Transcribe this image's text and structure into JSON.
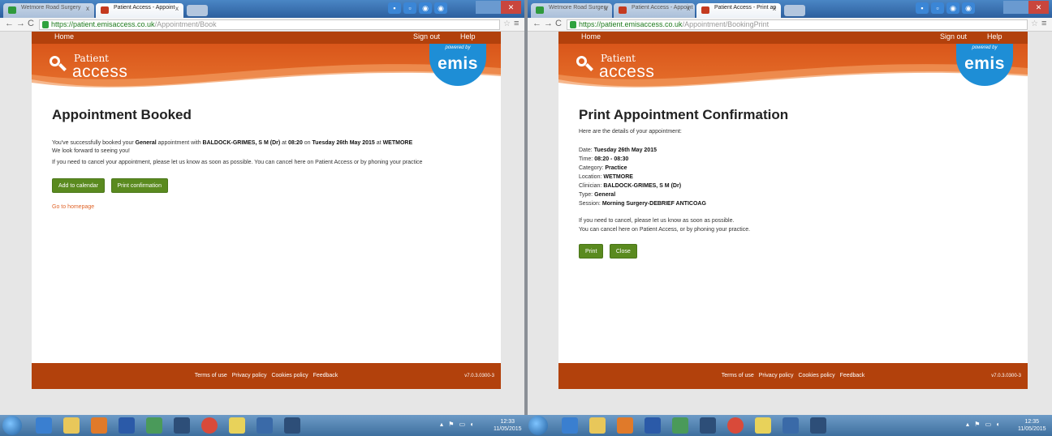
{
  "left_window": {
    "tabs": [
      {
        "label": "Wetmore Road Surgery"
      },
      {
        "label": "Patient Access - Appoint"
      }
    ],
    "url": {
      "host": "https://patient.emisaccess.co.uk",
      "path": "/Appointment/Book"
    },
    "site": {
      "nav": {
        "home": "Home",
        "sign_out": "Sign out",
        "help": "Help"
      },
      "logo": {
        "line1": "Patient",
        "line2": "access"
      },
      "emis": {
        "powered_by": "powered by",
        "name": "emis"
      },
      "title": "Appointment Booked",
      "message": {
        "p1_a": "You've successfully booked your ",
        "type": "General",
        "p1_b": " appointment with ",
        "clinician": "BALDOCK-GRIMES, S M (Dr)",
        "p1_c": " at ",
        "time": "08:20",
        "p1_d": " on ",
        "date": "Tuesday 26th May 2015",
        "p1_e": " at ",
        "location": "WETMORE",
        "p2": "We look forward to seeing you!",
        "p3": "If you need to cancel your appointment, please let us know as soon as possible. You can cancel here on Patient Access or by phoning your practice"
      },
      "buttons": {
        "add_calendar": "Add to calendar",
        "print_confirmation": "Print confirmation"
      },
      "homepage_link": "Go to homepage",
      "footer": {
        "terms": "Terms of use",
        "privacy": "Privacy policy",
        "cookies": "Cookies policy",
        "feedback": "Feedback",
        "version": "v7.0.3.0300-3"
      }
    },
    "taskbar_clock": {
      "time": "12:33",
      "date": "11/05/2015"
    }
  },
  "right_window": {
    "tabs": [
      {
        "label": "Wetmore Road Surgery"
      },
      {
        "label": "Patient Access - Appoint"
      },
      {
        "label": "Patient Access - Print ap"
      }
    ],
    "url": {
      "host": "https://patient.emisaccess.co.uk",
      "path": "/Appointment/BookingPrint"
    },
    "site": {
      "nav": {
        "home": "Home",
        "sign_out": "Sign out",
        "help": "Help"
      },
      "logo": {
        "line1": "Patient",
        "line2": "access"
      },
      "emis": {
        "powered_by": "powered by",
        "name": "emis"
      },
      "title": "Print Appointment Confirmation",
      "intro": "Here are the details of your appointment:",
      "details": [
        {
          "label": "Date:",
          "value": "Tuesday 26th May 2015"
        },
        {
          "label": "Time:",
          "value": "08:20 - 08:30"
        },
        {
          "label": "Category:",
          "value": "Practice"
        },
        {
          "label": "Location:",
          "value": "WETMORE"
        },
        {
          "label": "Clinician:",
          "value": "BALDOCK-GRIMES, S M (Dr)"
        },
        {
          "label": "Type:",
          "value": "General"
        },
        {
          "label": "Session:",
          "value": "Morning Surgery-DEBRIEF ANTICOAG"
        }
      ],
      "cancel_1": "If you need to cancel, please let us know as soon as possible.",
      "cancel_2": "You can cancel here on Patient Access, or by phoning your practice.",
      "buttons": {
        "print": "Print",
        "close": "Close"
      },
      "footer": {
        "terms": "Terms of use",
        "privacy": "Privacy policy",
        "cookies": "Cookies policy",
        "feedback": "Feedback",
        "version": "v7.0.3.0300-3"
      }
    },
    "taskbar_clock": {
      "time": "12:35",
      "date": "11/05/2015"
    }
  },
  "colors": {
    "brand_orange": "#b2410c",
    "hero_orange": "#e06224",
    "emis_blue": "#1e8ed6",
    "button_green": "#5a8a1f",
    "link_orange": "#e0652a"
  }
}
